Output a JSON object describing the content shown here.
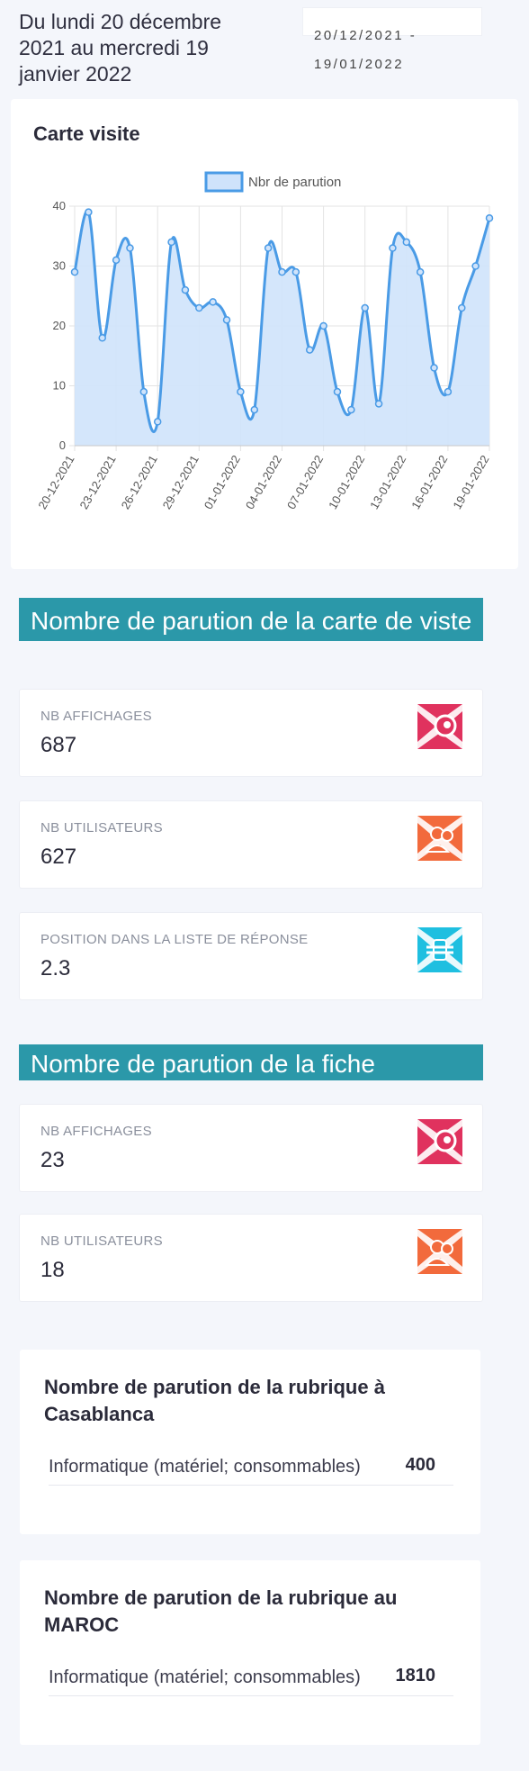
{
  "header": {
    "title": "Du lundi 20 décembre 2021 au mercredi 19 janvier 2022",
    "date_range": "20/12/2021 - 19/01/2022"
  },
  "visit_card_chart": {
    "title": "Carte visite"
  },
  "chart_data": {
    "type": "area",
    "title": "Carte visite",
    "series": [
      {
        "name": "Nbr de parution",
        "values": [
          29,
          39,
          18,
          31,
          33,
          9,
          4,
          34,
          26,
          23,
          24,
          21,
          9,
          6,
          33,
          29,
          29,
          16,
          20,
          9,
          6,
          23,
          7,
          33,
          34,
          29,
          13,
          9,
          23,
          30,
          38
        ]
      }
    ],
    "x": [
      "20-12-2021",
      "21-12-2021",
      "22-12-2021",
      "23-12-2021",
      "24-12-2021",
      "25-12-2021",
      "26-12-2021",
      "27-12-2021",
      "28-12-2021",
      "29-12-2021",
      "30-12-2021",
      "31-12-2021",
      "01-01-2022",
      "02-01-2022",
      "03-01-2022",
      "04-01-2022",
      "05-01-2022",
      "06-01-2022",
      "07-01-2022",
      "08-01-2022",
      "09-01-2022",
      "10-01-2022",
      "11-01-2022",
      "12-01-2022",
      "13-01-2022",
      "14-01-2022",
      "15-01-2022",
      "16-01-2022",
      "17-01-2022",
      "18-01-2022",
      "19-01-2022"
    ],
    "x_tick_labels": [
      "20-12-2021",
      "23-12-2021",
      "26-12-2021",
      "29-12-2021",
      "01-01-2022",
      "04-01-2022",
      "07-01-2022",
      "10-01-2022",
      "13-01-2022",
      "16-01-2022",
      "19-01-2022"
    ],
    "y_ticks": [
      0,
      10,
      20,
      30,
      40
    ],
    "ylim": [
      0,
      40
    ],
    "grid": true,
    "legend": "top-center",
    "colors": {
      "line": "#4a9be6",
      "fill": "#cfe3fb"
    }
  },
  "visit_section": {
    "title": "Nombre de parution de la carte de viste",
    "stats": [
      {
        "label": "NB AFFICHAGES",
        "value": "687",
        "icon": "eye-icon",
        "color": "#e0325e"
      },
      {
        "label": "NB UTILISATEURS",
        "value": "627",
        "icon": "users-icon",
        "color": "#f26a3c"
      },
      {
        "label": "POSITION DANS LA LISTE DE RÉPONSE",
        "value": "2.3",
        "icon": "list-icon",
        "color": "#1fbfe0"
      }
    ]
  },
  "fiche_section": {
    "title": "Nombre de parution de la fiche",
    "stats": [
      {
        "label": "NB AFFICHAGES",
        "value": "23",
        "icon": "eye-icon",
        "color": "#e0325e"
      },
      {
        "label": "NB UTILISATEURS",
        "value": "18",
        "icon": "users-icon",
        "color": "#f26a3c"
      }
    ]
  },
  "rubrique_casablanca": {
    "title": "Nombre de parution de la rubrique à Casablanca",
    "rows": [
      {
        "name": "Informatique (matériel; consommables)",
        "value": "400"
      }
    ]
  },
  "rubrique_maroc": {
    "title": "Nombre de parution de la rubrique au MAROC",
    "rows": [
      {
        "name": "Informatique (matériel; consommables)",
        "value": "1810"
      }
    ]
  }
}
